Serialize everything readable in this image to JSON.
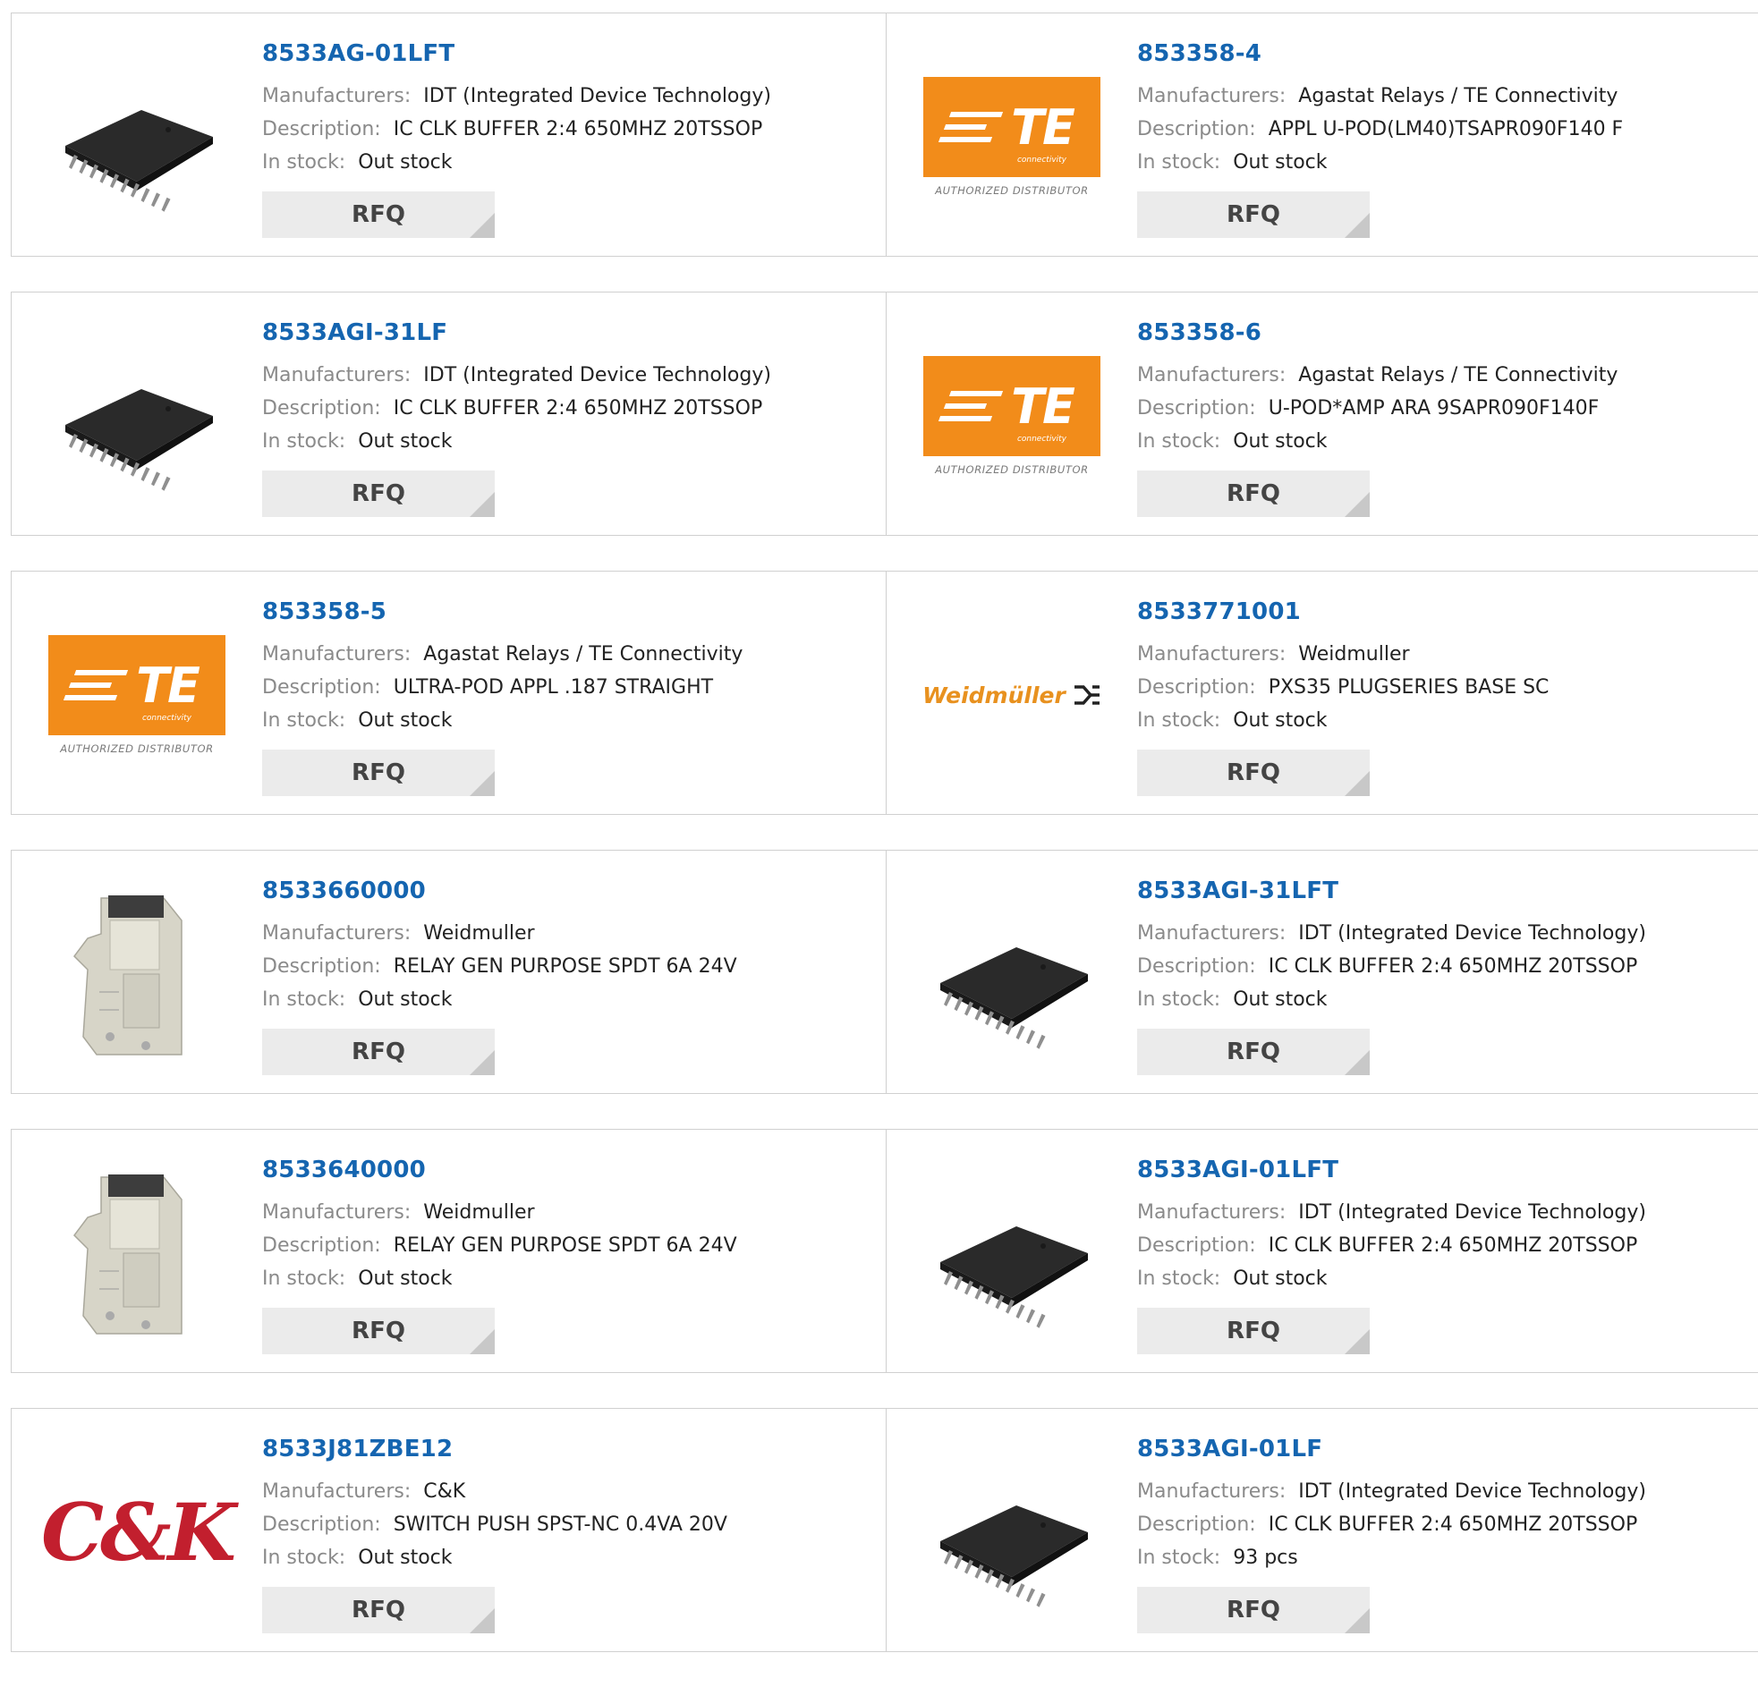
{
  "labels": {
    "manufacturers": "Manufacturers:",
    "description": "Description:",
    "in_stock": "In stock:",
    "rfq": "RFQ"
  },
  "products": [
    {
      "part": "8533AG-01LFT",
      "manufacturer": "IDT (Integrated Device Technology)",
      "description": "IC CLK BUFFER 2:4 650MHZ 20TSSOP",
      "stock": "Out stock",
      "image": "tssop-chip-icon"
    },
    {
      "part": "853358-4",
      "manufacturer": "Agastat Relays / TE Connectivity",
      "description": "APPL U-POD(LM40)TSAPR090F140 F",
      "stock": "Out stock",
      "image": "te-connectivity-logo"
    },
    {
      "part": "8533AGI-31LF",
      "manufacturer": "IDT (Integrated Device Technology)",
      "description": "IC CLK BUFFER 2:4 650MHZ 20TSSOP",
      "stock": "Out stock",
      "image": "tssop-chip-icon"
    },
    {
      "part": "853358-6",
      "manufacturer": "Agastat Relays / TE Connectivity",
      "description": "U-POD*AMP ARA 9SAPR090F140F",
      "stock": "Out stock",
      "image": "te-connectivity-logo"
    },
    {
      "part": "853358-5",
      "manufacturer": "Agastat Relays / TE Connectivity",
      "description": "ULTRA-POD APPL .187 STRAIGHT",
      "stock": "Out stock",
      "image": "te-connectivity-logo"
    },
    {
      "part": "8533771001",
      "manufacturer": "Weidmuller",
      "description": "PXS35 PLUGSERIES BASE SC",
      "stock": "Out stock",
      "image": "weidmuller-logo"
    },
    {
      "part": "8533660000",
      "manufacturer": "Weidmuller",
      "description": "RELAY GEN PURPOSE SPDT 6A 24V",
      "stock": "Out stock",
      "image": "relay-module-icon"
    },
    {
      "part": "8533AGI-31LFT",
      "manufacturer": "IDT (Integrated Device Technology)",
      "description": "IC CLK BUFFER 2:4 650MHZ 20TSSOP",
      "stock": "Out stock",
      "image": "tssop-chip-icon"
    },
    {
      "part": "8533640000",
      "manufacturer": "Weidmuller",
      "description": "RELAY GEN PURPOSE SPDT 6A 24V",
      "stock": "Out stock",
      "image": "relay-module-icon"
    },
    {
      "part": "8533AGI-01LFT",
      "manufacturer": "IDT (Integrated Device Technology)",
      "description": "IC CLK BUFFER 2:4 650MHZ 20TSSOP",
      "stock": "Out stock",
      "image": "tssop-chip-icon"
    },
    {
      "part": "8533J81ZBE12",
      "manufacturer": "C&K",
      "description": "SWITCH PUSH SPST-NC 0.4VA 20V",
      "stock": "Out stock",
      "image": "ck-logo"
    },
    {
      "part": "8533AGI-01LF",
      "manufacturer": "IDT (Integrated Device Technology)",
      "description": "IC CLK BUFFER 2:4 650MHZ 20TSSOP",
      "stock": "93 pcs",
      "image": "tssop-chip-icon"
    }
  ],
  "logos": {
    "te_brand": "TE",
    "te_sub": "connectivity",
    "te_authorized": "AUTHORIZED DISTRIBUTOR",
    "weidmuller_brand": "Weidmüller",
    "ck_brand": "C&K"
  },
  "colors": {
    "part_link": "#1565b0",
    "te_orange": "#f28c1a",
    "weidmuller_orange": "#e8911f",
    "ck_red": "#c21f2e"
  }
}
